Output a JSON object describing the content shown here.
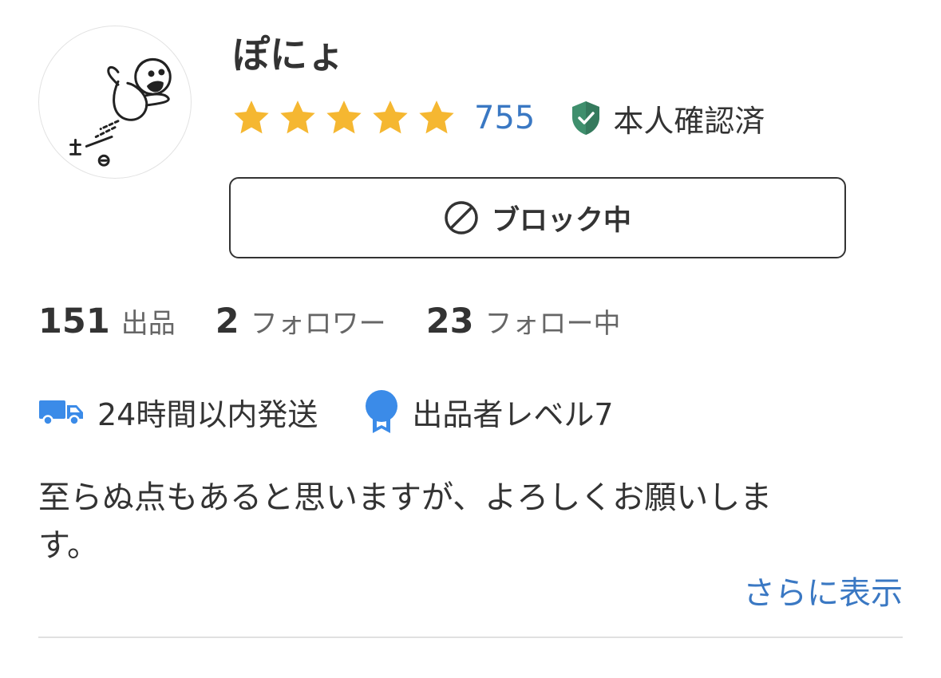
{
  "profile": {
    "name": "ぽにょ",
    "rating": 5,
    "rating_count": "755",
    "verified_label": "本人確認済",
    "star_color": "#f5b731",
    "link_color": "#3a78c3"
  },
  "block_button": {
    "label": "ブロック中",
    "icon": "prohibited-icon"
  },
  "stats": [
    {
      "value": "151",
      "label": "出品"
    },
    {
      "value": "2",
      "label": "フォロワー"
    },
    {
      "value": "23",
      "label": "フォロー中"
    }
  ],
  "badges": [
    {
      "icon": "truck-icon",
      "label": "24時間以内発送"
    },
    {
      "icon": "medal-icon",
      "label": "出品者レベル7"
    }
  ],
  "bio": "至らぬ点もあると思いますが、よろしくお願いします。",
  "more_link": "さらに表示"
}
